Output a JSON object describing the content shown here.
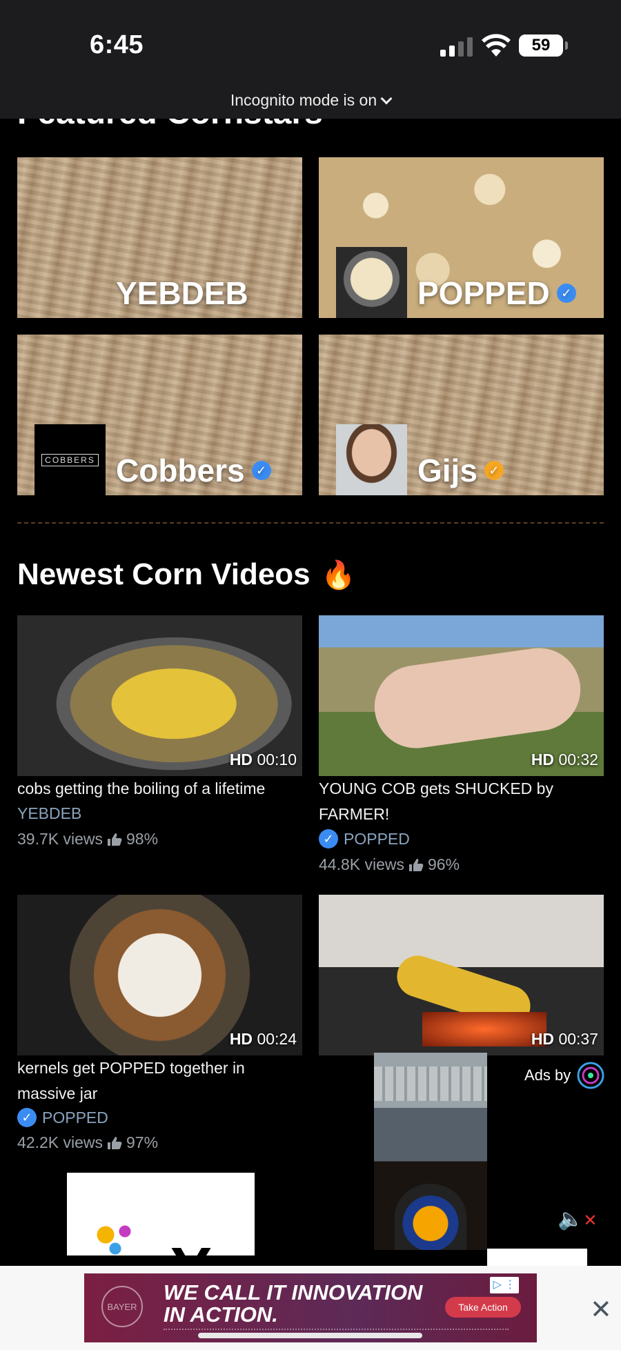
{
  "status": {
    "time": "6:45",
    "battery": "59",
    "incognito": "Incognito mode is on"
  },
  "featured": {
    "heading": "Featured Cornstars",
    "tiles": [
      {
        "name": "YEBDEB",
        "verified": false
      },
      {
        "name": "POPPED",
        "verified": true,
        "badge_color": "#3b8cf2"
      },
      {
        "name": "Cobbers",
        "verified": true,
        "badge_color": "#3b8cf2",
        "avatar_text": "COBBERS"
      },
      {
        "name": "Gijs",
        "verified": true,
        "badge_color": "#f5a623"
      }
    ]
  },
  "newest": {
    "heading": "Newest Corn Videos",
    "heading_emoji": "🔥",
    "videos": [
      {
        "quality": "HD",
        "duration": "00:10",
        "title": "cobs getting the boiling of a lifetime",
        "channel": "YEBDEB",
        "verified": false,
        "views": "39.7K views",
        "rating": "98%"
      },
      {
        "quality": "HD",
        "duration": "00:32",
        "title": "YOUNG COB gets SHUCKED by FARMER!",
        "channel": "POPPED",
        "verified": true,
        "views": "44.8K views",
        "rating": "96%"
      },
      {
        "quality": "HD",
        "duration": "00:24",
        "title": "kernels get POPPED together in massive jar",
        "channel": "POPPED",
        "verified": true,
        "views": "42.2K views",
        "rating": "97%"
      },
      {
        "quality": "HD",
        "duration": "00:37",
        "title": "",
        "channel": "",
        "verified": false,
        "views": "",
        "rating": ""
      }
    ]
  },
  "ads": {
    "ads_by": "Ads by",
    "popup_text": "You won!",
    "banner_headline_1": "WE CALL IT INNOVATION",
    "banner_headline_2": "IN ACTION.",
    "banner_brand": "BAYER",
    "banner_cta": "Take Action",
    "close_symbol": "✕",
    "mute_symbol": "🔈"
  },
  "colors": {
    "background": "#000000",
    "verified_blue": "#3b8cf2",
    "gold_badge": "#f5a623",
    "channel_link": "#8aa4bf"
  }
}
